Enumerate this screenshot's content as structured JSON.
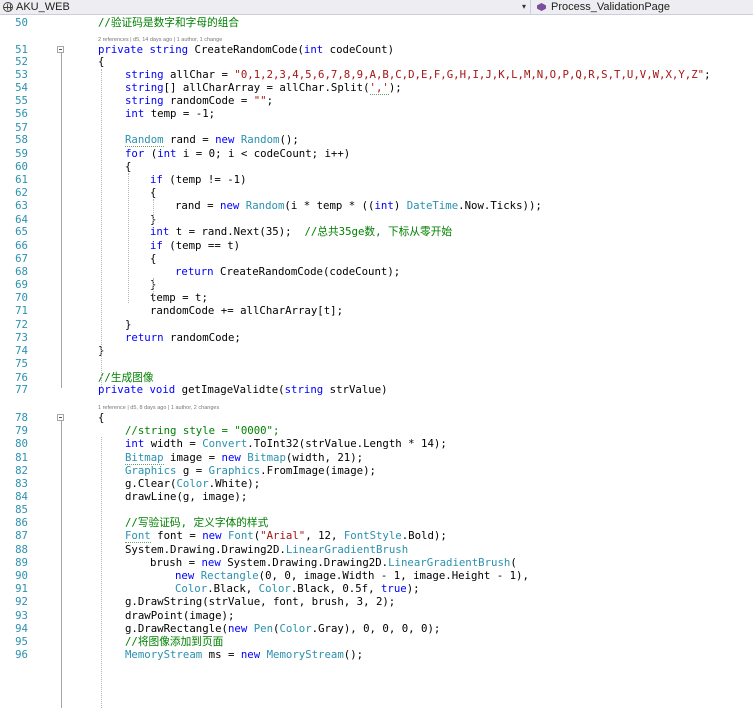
{
  "topbar": {
    "project": "AKU_WEB",
    "member": "Process_ValidationPage",
    "dropdown_arrow": "▾",
    "icons": {
      "project": "globe-icon",
      "member": "method-icon"
    }
  },
  "codelens": {
    "line51": "2 references | d5, 14 days ago | 1 author, 1 change",
    "line77": "1 reference | d5, 8 days ago | 1 author, 2 changes"
  },
  "lines": [
    {
      "n": "50",
      "segs": [
        {
          "t": "//验证码是数字和字母的组合",
          "c": "c"
        }
      ]
    },
    {
      "n": "51",
      "segs": [
        {
          "t": "private",
          "c": "k"
        },
        {
          "t": " "
        },
        {
          "t": "string",
          "c": "k"
        },
        {
          "t": " CreateRandomCode("
        },
        {
          "t": "int",
          "c": "k"
        },
        {
          "t": " codeCount)"
        }
      ]
    },
    {
      "n": "52",
      "segs": [
        {
          "t": "{"
        }
      ]
    },
    {
      "n": "53",
      "segs": [
        {
          "t": "string",
          "c": "k"
        },
        {
          "t": " allChar = "
        },
        {
          "t": "\"0,1,2,3,4,5,6,7,8,9,A,B,C,D,E,F,G,H,I,J,K,L,M,N,O,P,Q,R,S,T,U,V,W,X,Y,Z\"",
          "c": "s"
        },
        {
          "t": ";"
        }
      ]
    },
    {
      "n": "54",
      "segs": [
        {
          "t": "string",
          "c": "k"
        },
        {
          "t": "[] allCharArray = allChar.Split("
        },
        {
          "t": "','",
          "c": "s"
        },
        {
          "t": ");"
        }
      ]
    },
    {
      "n": "55",
      "segs": [
        {
          "t": "string",
          "c": "k"
        },
        {
          "t": " randomCode = "
        },
        {
          "t": "\"\"",
          "c": "s"
        },
        {
          "t": ";"
        }
      ]
    },
    {
      "n": "56",
      "segs": [
        {
          "t": "int",
          "c": "k"
        },
        {
          "t": " temp = -1;"
        }
      ]
    },
    {
      "n": "57",
      "segs": []
    },
    {
      "n": "58",
      "segs": [
        {
          "t": "Random",
          "c": "t"
        },
        {
          "t": " rand = "
        },
        {
          "t": "new",
          "c": "k"
        },
        {
          "t": " "
        },
        {
          "t": "Random",
          "c": "t"
        },
        {
          "t": "();"
        }
      ]
    },
    {
      "n": "59",
      "segs": [
        {
          "t": "for",
          "c": "k"
        },
        {
          "t": " ("
        },
        {
          "t": "int",
          "c": "k"
        },
        {
          "t": " i = 0; i < codeCount; i++)"
        }
      ]
    },
    {
      "n": "60",
      "segs": [
        {
          "t": "{"
        }
      ]
    },
    {
      "n": "61",
      "segs": [
        {
          "t": "if",
          "c": "k"
        },
        {
          "t": " (temp != -1)"
        }
      ]
    },
    {
      "n": "62",
      "segs": [
        {
          "t": "{"
        }
      ]
    },
    {
      "n": "63",
      "segs": [
        {
          "t": "rand = "
        },
        {
          "t": "new",
          "c": "k"
        },
        {
          "t": " "
        },
        {
          "t": "Random",
          "c": "t"
        },
        {
          "t": "(i * temp * (("
        },
        {
          "t": "int",
          "c": "k"
        },
        {
          "t": ") "
        },
        {
          "t": "DateTime",
          "c": "t"
        },
        {
          "t": ".Now.Ticks));"
        }
      ]
    },
    {
      "n": "64",
      "segs": [
        {
          "t": "}"
        }
      ]
    },
    {
      "n": "65",
      "segs": [
        {
          "t": "int",
          "c": "k"
        },
        {
          "t": " t = rand.Next(35);  "
        },
        {
          "t": "//总共35ge数, 下标从零开始",
          "c": "c"
        }
      ]
    },
    {
      "n": "66",
      "segs": [
        {
          "t": "if",
          "c": "k"
        },
        {
          "t": " (temp == t)"
        }
      ]
    },
    {
      "n": "67",
      "segs": [
        {
          "t": "{"
        }
      ]
    },
    {
      "n": "68",
      "segs": [
        {
          "t": "return",
          "c": "k"
        },
        {
          "t": " CreateRandomCode(codeCount);"
        }
      ]
    },
    {
      "n": "69",
      "segs": [
        {
          "t": "}"
        }
      ]
    },
    {
      "n": "70",
      "segs": [
        {
          "t": "temp = t;"
        }
      ]
    },
    {
      "n": "71",
      "segs": [
        {
          "t": "randomCode += allCharArray[t];"
        }
      ]
    },
    {
      "n": "72",
      "segs": [
        {
          "t": "}"
        }
      ]
    },
    {
      "n": "73",
      "segs": [
        {
          "t": "return",
          "c": "k"
        },
        {
          "t": " randomCode;"
        }
      ]
    },
    {
      "n": "74",
      "segs": [
        {
          "t": "}"
        }
      ]
    },
    {
      "n": "75",
      "segs": []
    },
    {
      "n": "76",
      "segs": [
        {
          "t": "//生成图像",
          "c": "c"
        }
      ]
    },
    {
      "n": "77",
      "segs": [
        {
          "t": "private",
          "c": "k"
        },
        {
          "t": " "
        },
        {
          "t": "void",
          "c": "k"
        },
        {
          "t": " getImageValidte("
        },
        {
          "t": "string",
          "c": "k"
        },
        {
          "t": " strValue)"
        }
      ]
    },
    {
      "n": "78",
      "segs": [
        {
          "t": "{"
        }
      ]
    },
    {
      "n": "79",
      "segs": [
        {
          "t": "//string style = \"0000\";",
          "c": "c"
        }
      ]
    },
    {
      "n": "80",
      "segs": [
        {
          "t": "int",
          "c": "k"
        },
        {
          "t": " width = "
        },
        {
          "t": "Convert",
          "c": "t"
        },
        {
          "t": ".ToInt32(strValue.Length * 14);"
        }
      ]
    },
    {
      "n": "81",
      "segs": [
        {
          "t": "Bitmap",
          "c": "t"
        },
        {
          "t": " image = "
        },
        {
          "t": "new",
          "c": "k"
        },
        {
          "t": " "
        },
        {
          "t": "Bitmap",
          "c": "t"
        },
        {
          "t": "(width, 21);"
        }
      ]
    },
    {
      "n": "82",
      "segs": [
        {
          "t": "Graphics",
          "c": "t"
        },
        {
          "t": " g = "
        },
        {
          "t": "Graphics",
          "c": "t"
        },
        {
          "t": ".FromImage(image);"
        }
      ]
    },
    {
      "n": "83",
      "segs": [
        {
          "t": "g.Clear("
        },
        {
          "t": "Color",
          "c": "t"
        },
        {
          "t": ".White);"
        }
      ]
    },
    {
      "n": "84",
      "segs": [
        {
          "t": "drawLine(g, image);"
        }
      ]
    },
    {
      "n": "85",
      "segs": []
    },
    {
      "n": "86",
      "segs": [
        {
          "t": "//写验证码, 定义字体的样式",
          "c": "c"
        }
      ]
    },
    {
      "n": "87",
      "segs": [
        {
          "t": "Font",
          "c": "t"
        },
        {
          "t": " font = "
        },
        {
          "t": "new",
          "c": "k"
        },
        {
          "t": " "
        },
        {
          "t": "Font",
          "c": "t"
        },
        {
          "t": "("
        },
        {
          "t": "\"Arial\"",
          "c": "s"
        },
        {
          "t": ", 12, "
        },
        {
          "t": "FontStyle",
          "c": "t"
        },
        {
          "t": ".Bold);"
        }
      ]
    },
    {
      "n": "88",
      "segs": [
        {
          "t": "System.Drawing.Drawing2D."
        },
        {
          "t": "LinearGradientBrush",
          "c": "t"
        }
      ]
    },
    {
      "n": "89",
      "segs": [
        {
          "t": "brush = "
        },
        {
          "t": "new",
          "c": "k"
        },
        {
          "t": " System.Drawing.Drawing2D."
        },
        {
          "t": "LinearGradientBrush",
          "c": "t"
        },
        {
          "t": "("
        }
      ]
    },
    {
      "n": "90",
      "segs": [
        {
          "t": "new",
          "c": "k"
        },
        {
          "t": " "
        },
        {
          "t": "Rectangle",
          "c": "t"
        },
        {
          "t": "(0, 0, image.Width - 1, image.Height - 1),"
        }
      ]
    },
    {
      "n": "91",
      "segs": [
        {
          "t": "Color",
          "c": "t"
        },
        {
          "t": ".Black, "
        },
        {
          "t": "Color",
          "c": "t"
        },
        {
          "t": ".Black, 0.5f, "
        },
        {
          "t": "true",
          "c": "k"
        },
        {
          "t": ");"
        }
      ]
    },
    {
      "n": "92",
      "segs": [
        {
          "t": "g.DrawString(strValue, font, brush, 3, 2);"
        }
      ]
    },
    {
      "n": "93",
      "segs": [
        {
          "t": "drawPoint(image);"
        }
      ]
    },
    {
      "n": "94",
      "segs": [
        {
          "t": "g.DrawRectangle("
        },
        {
          "t": "new",
          "c": "k"
        },
        {
          "t": " "
        },
        {
          "t": "Pen",
          "c": "t"
        },
        {
          "t": "("
        },
        {
          "t": "Color",
          "c": "t"
        },
        {
          "t": ".Gray), 0, 0, 0, 0);"
        }
      ]
    },
    {
      "n": "95",
      "segs": [
        {
          "t": "//将图像添加到页面",
          "c": "c"
        }
      ]
    },
    {
      "n": "96",
      "segs": [
        {
          "t": "MemoryStream",
          "c": "t"
        },
        {
          "t": " ms = "
        },
        {
          "t": "new",
          "c": "k"
        },
        {
          "t": " "
        },
        {
          "t": "MemoryStream",
          "c": "t"
        },
        {
          "t": "();"
        }
      ]
    }
  ]
}
